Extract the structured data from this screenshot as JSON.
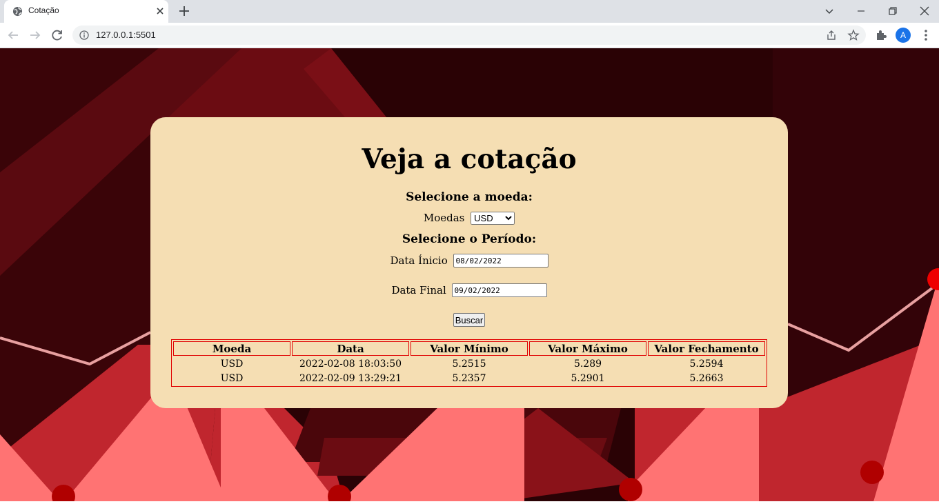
{
  "browser": {
    "tab_title": "Cotação",
    "url": "127.0.0.1:5501",
    "profile_initial": "A",
    "icons": {
      "favicon": "globe-icon",
      "tab_close": "close-icon",
      "new_tab": "plus-icon",
      "tab_search": "chevron-down-icon",
      "minimize": "minimize-icon",
      "restore": "restore-icon",
      "close_window": "close-icon",
      "back": "arrow-left-icon",
      "forward": "arrow-right-icon",
      "reload": "reload-icon",
      "site_info": "info-icon",
      "share": "share-icon",
      "bookmark": "star-icon",
      "extensions": "puzzle-icon",
      "menu": "kebab-menu-icon"
    }
  },
  "page": {
    "title": "Veja a cotação",
    "currency_section": {
      "heading": "Selecione a moeda:",
      "label": "Moedas",
      "selected": "USD"
    },
    "period_section": {
      "heading": "Selecione o Período:",
      "start_label": "Data Ínicio",
      "start_value": "08/02/2022",
      "end_label": "Data Final",
      "end_value": "09/02/2022"
    },
    "search_button": "Buscar",
    "table": {
      "headers": [
        "Moeda",
        "Data",
        "Valor Mínimo",
        "Valor Máximo",
        "Valor Fechamento"
      ],
      "rows": [
        [
          "USD",
          "2022-02-08 18:03:50",
          "5.2515",
          "5.289",
          "5.2594"
        ],
        [
          "USD",
          "2022-02-09 13:29:21",
          "5.2357",
          "5.2901",
          "5.2663"
        ]
      ]
    }
  },
  "colors": {
    "card_background": "#f5deb3",
    "table_border": "#e00000",
    "background_dark": "#2a0205",
    "background_red": "#c0262e",
    "background_pink": "#ff7373"
  }
}
